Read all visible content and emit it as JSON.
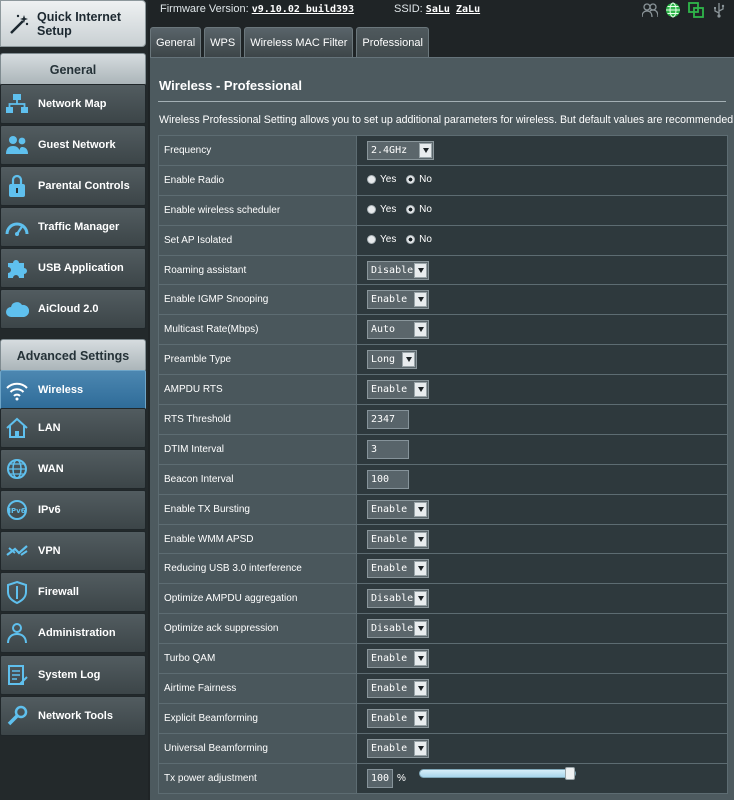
{
  "sidebar": {
    "quick_setup": "Quick Internet Setup",
    "general_head": "General",
    "general_items": [
      "Network Map",
      "Guest Network",
      "Parental Controls",
      "Traffic Manager",
      "USB Application",
      "AiCloud 2.0"
    ],
    "advanced_head": "Advanced Settings",
    "advanced_items": [
      "Wireless",
      "LAN",
      "WAN",
      "IPv6",
      "VPN",
      "Firewall",
      "Administration",
      "System Log",
      "Network Tools"
    ],
    "active_item": "Wireless"
  },
  "topbar": {
    "firmware_label": "Firmware Version:",
    "firmware_value": "v9.10.02 build393",
    "ssid_label": "SSID:",
    "ssid_values": [
      "SaLu",
      "ZaLu"
    ],
    "icons": [
      "users-icon",
      "globe-icon",
      "network-copy-icon",
      "usb-icon"
    ]
  },
  "tabs": [
    "General",
    "WPS",
    "Wireless MAC Filter",
    "Professional"
  ],
  "active_tab": "Professional",
  "panel": {
    "title": "Wireless - Professional",
    "description": "Wireless Professional Setting allows you to set up additional parameters for wireless. But default values are recommended."
  },
  "settings": {
    "frequency": {
      "label": "Frequency",
      "value": "2.4GHz"
    },
    "enable_radio": {
      "label": "Enable Radio",
      "yes": "Yes",
      "no": "No",
      "selected": "No"
    },
    "wireless_scheduler": {
      "label": "Enable wireless scheduler",
      "yes": "Yes",
      "no": "No",
      "selected": "No"
    },
    "ap_isolated": {
      "label": "Set AP Isolated",
      "yes": "Yes",
      "no": "No",
      "selected": "No"
    },
    "roaming_assistant": {
      "label": "Roaming assistant",
      "value": "Disable"
    },
    "igmp_snooping": {
      "label": "Enable IGMP Snooping",
      "value": "Enable"
    },
    "multicast_rate": {
      "label": "Multicast Rate(Mbps)",
      "value": "Auto"
    },
    "preamble_type": {
      "label": "Preamble Type",
      "value": "Long"
    },
    "ampdu_rts": {
      "label": "AMPDU RTS",
      "value": "Enable"
    },
    "rts_threshold": {
      "label": "RTS Threshold",
      "value": "2347"
    },
    "dtim_interval": {
      "label": "DTIM Interval",
      "value": "3"
    },
    "beacon_interval": {
      "label": "Beacon Interval",
      "value": "100"
    },
    "tx_bursting": {
      "label": "Enable TX Bursting",
      "value": "Enable"
    },
    "wmm_apsd": {
      "label": "Enable WMM APSD",
      "value": "Enable"
    },
    "usb3_interference": {
      "label": "Reducing USB 3.0 interference",
      "value": "Enable"
    },
    "ampdu_aggregation": {
      "label": "Optimize AMPDU aggregation",
      "value": "Disable"
    },
    "ack_suppression": {
      "label": "Optimize ack suppression",
      "value": "Disable"
    },
    "turbo_qam": {
      "label": "Turbo QAM",
      "value": "Enable"
    },
    "airtime_fairness": {
      "label": "Airtime Fairness",
      "value": "Enable"
    },
    "explicit_beamforming": {
      "label": "Explicit Beamforming",
      "value": "Enable"
    },
    "universal_beamforming": {
      "label": "Universal Beamforming",
      "value": "Enable"
    },
    "tx_power": {
      "label": "Tx power adjustment",
      "value": "100",
      "unit": "%",
      "level": 1.0
    }
  },
  "colors": {
    "active_blue": "#2e6b98",
    "panel": "#4d5a5f",
    "cell_dark": "#2e393d"
  }
}
